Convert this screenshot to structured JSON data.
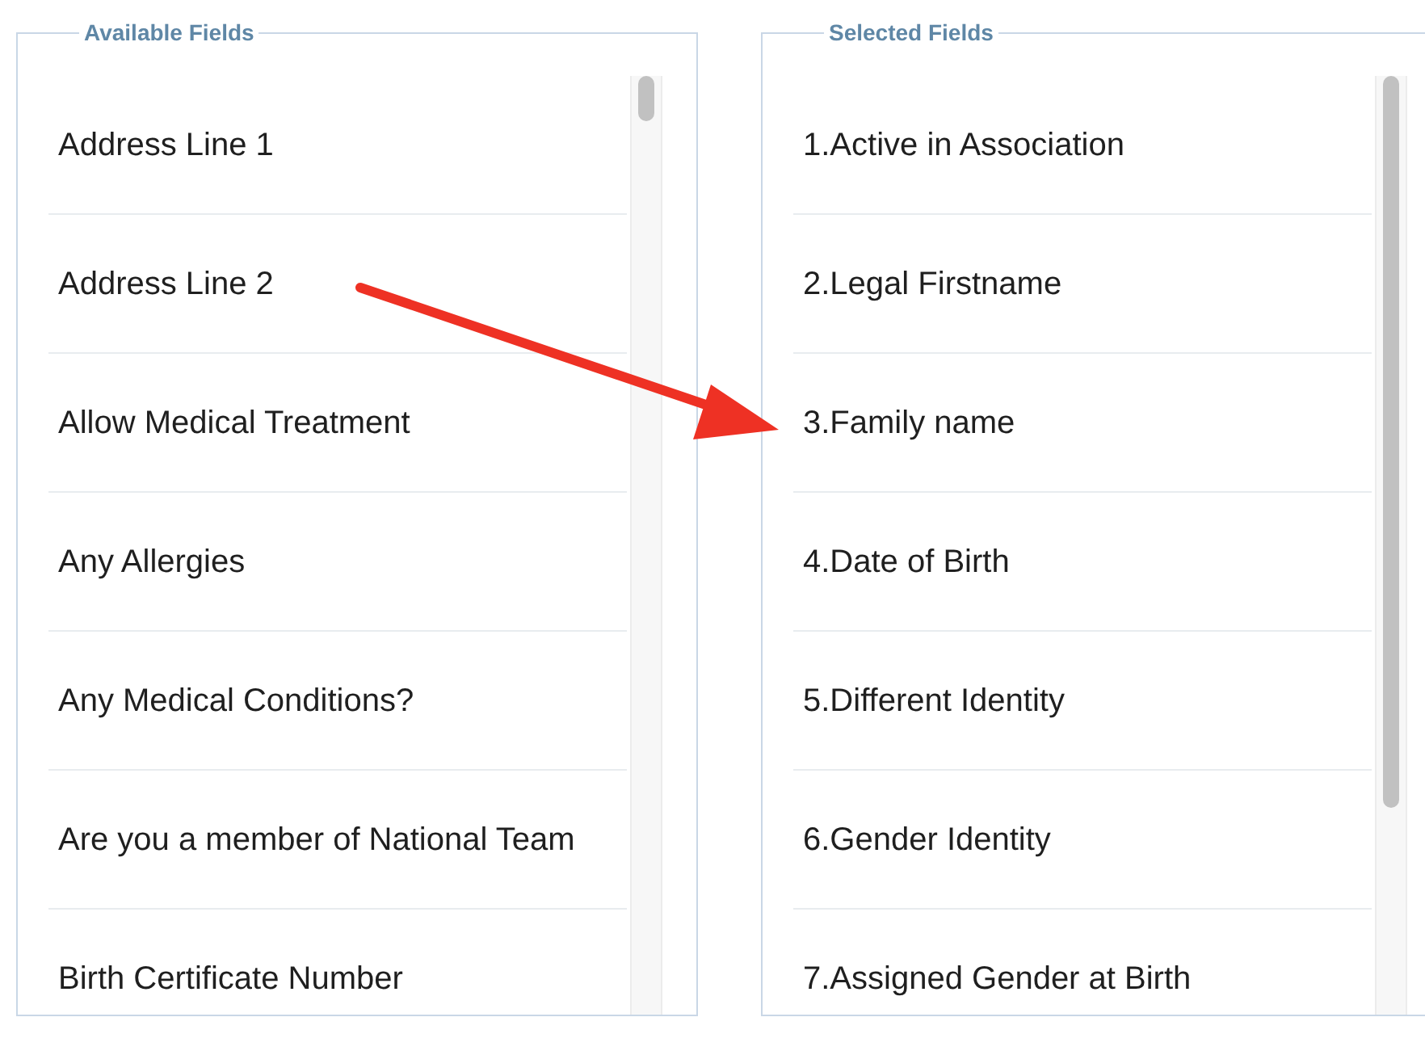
{
  "panels": [
    {
      "legend": "Available Fields",
      "items": [
        "Address Line 1",
        "Address Line 2",
        "Allow Medical Treatment",
        "Any Allergies",
        "Any Medical Conditions?",
        "Are you a member of National Team",
        "Birth Certificate Number"
      ]
    },
    {
      "legend": "Selected Fields",
      "items": [
        "1.Active in Association",
        "2.Legal Firstname",
        "3.Family name",
        "4.Date of Birth",
        "5.Different Identity",
        "6.Gender Identity",
        "7.Assigned Gender at Birth"
      ]
    }
  ]
}
